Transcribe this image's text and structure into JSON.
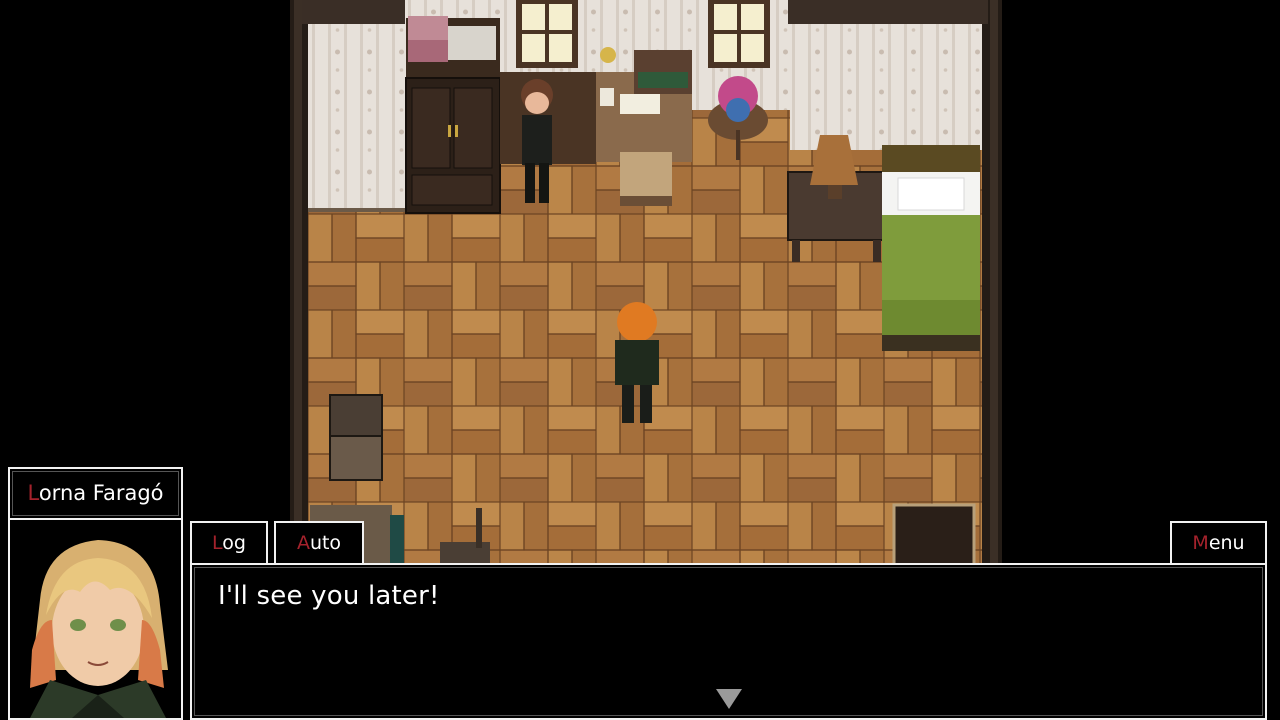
{
  "speaker": {
    "first_letter": "L",
    "rest": "orna Faragó"
  },
  "buttons": {
    "log": {
      "first_letter": "L",
      "rest": "og"
    },
    "auto": {
      "first_letter": "A",
      "rest": "uto"
    },
    "menu": {
      "first_letter": "M",
      "rest": "enu"
    }
  },
  "dialog": {
    "text": "I'll see you later!"
  },
  "icons": {
    "advance": "triangle-down-icon"
  },
  "colors": {
    "accent": "#a4222c",
    "border": "#f2f2f2",
    "floor": "#b07c45",
    "bed_blanket": "#7a9a3a"
  }
}
